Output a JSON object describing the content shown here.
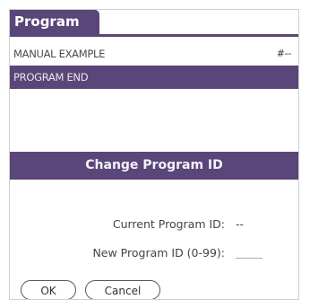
{
  "title": "Program",
  "list": [
    {
      "label": "MANUAL EXAMPLE",
      "value": "#--"
    },
    {
      "label": "PROGRAM END",
      "value": ""
    }
  ],
  "dialog": {
    "title": "Change Program ID",
    "current_label": "Current Program ID:",
    "current_value": "--",
    "new_label": "New Program ID (0-99):",
    "ok_label": "OK",
    "cancel_label": "Cancel"
  },
  "colors": {
    "accent": "#5a4678"
  }
}
